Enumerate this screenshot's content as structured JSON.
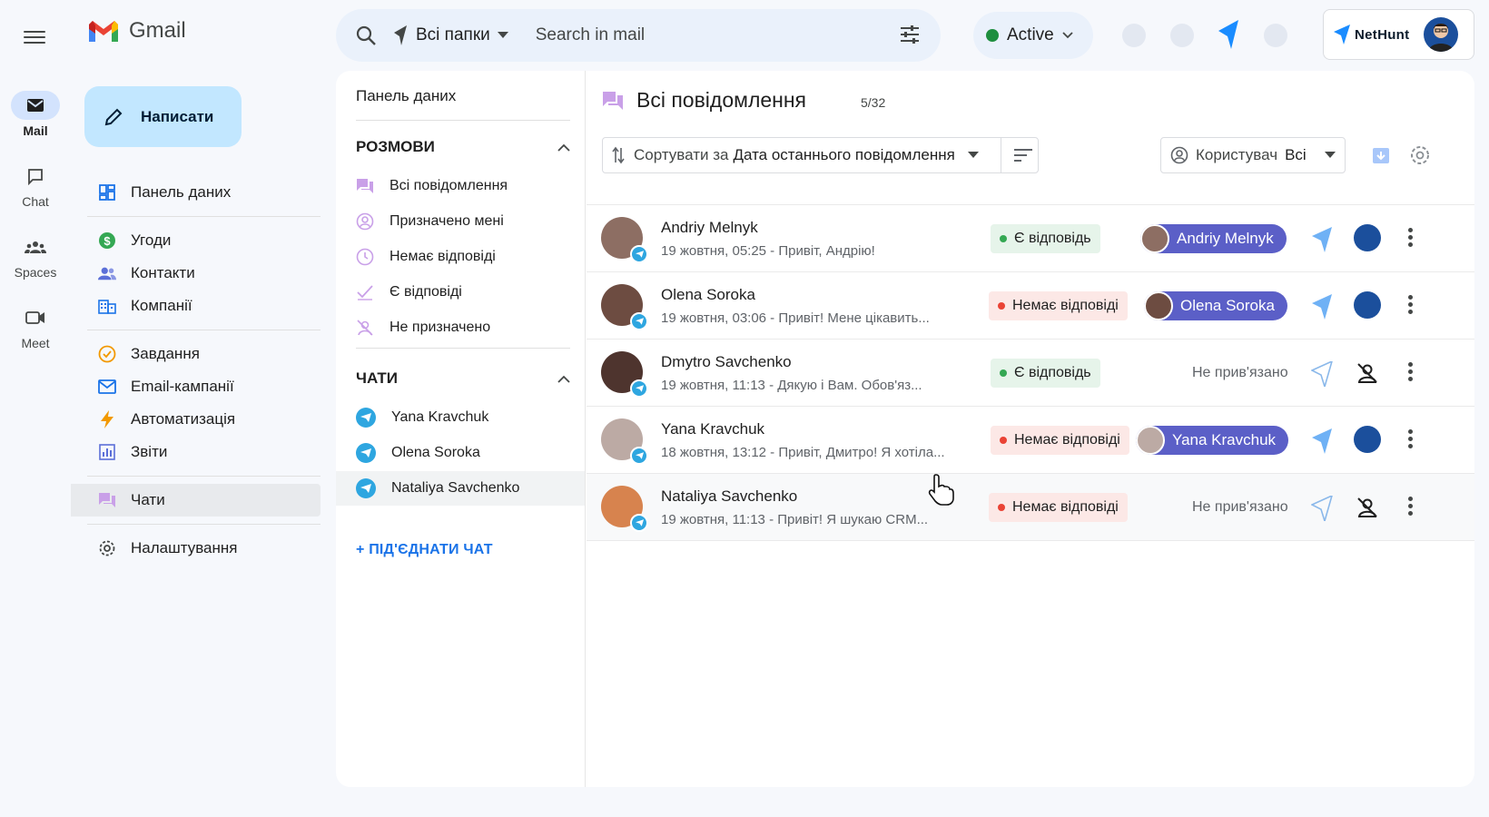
{
  "rail": {
    "items": [
      {
        "label": "Mail",
        "icon": "mail-icon"
      },
      {
        "label": "Chat",
        "icon": "chat-icon"
      },
      {
        "label": "Spaces",
        "icon": "spaces-icon"
      },
      {
        "label": "Meet",
        "icon": "meet-icon"
      }
    ]
  },
  "app": {
    "name": "Gmail"
  },
  "compose": {
    "label": "Написати"
  },
  "nav": {
    "items": [
      {
        "label": "Панель даних",
        "icon": "dashboard-icon"
      },
      {
        "label": "Угоди",
        "icon": "deals-icon"
      },
      {
        "label": "Контакти",
        "icon": "contacts-icon"
      },
      {
        "label": "Компанії",
        "icon": "companies-icon"
      },
      {
        "label": "Завдання",
        "icon": "tasks-icon"
      },
      {
        "label": "Email-кампанії",
        "icon": "email-campaigns-icon"
      },
      {
        "label": "Автоматизація",
        "icon": "automation-icon"
      },
      {
        "label": "Звіти",
        "icon": "reports-icon"
      },
      {
        "label": "Чати",
        "icon": "chats-icon"
      },
      {
        "label": "Налаштування",
        "icon": "settings-icon"
      }
    ]
  },
  "search": {
    "folder": "Всі папки",
    "placeholder": "Search in mail"
  },
  "status": {
    "label": "Active",
    "color": "#1e8e3e"
  },
  "brand": {
    "name": "NetHunt",
    "accent": "#1a73e8"
  },
  "leftPanel": {
    "title": "Панель даних",
    "conversations": {
      "heading": "РОЗМОВИ",
      "items": [
        {
          "label": "Всі повідомлення"
        },
        {
          "label": "Призначено мені"
        },
        {
          "label": "Немає відповіді"
        },
        {
          "label": "Є відповіді"
        },
        {
          "label": "Не призначено"
        }
      ]
    },
    "chats": {
      "heading": "ЧАТИ",
      "items": [
        {
          "label": "Yana Kravchuk"
        },
        {
          "label": "Olena Soroka"
        },
        {
          "label": "Nataliya Savchenko"
        }
      ]
    },
    "connect": "+ ПІД'ЄДНАТИ ЧАТ"
  },
  "main": {
    "title": "Всі повідомлення",
    "count": "5/32",
    "sort": {
      "prefix": "Сортувати за",
      "value": "Дата останнього повідомлення"
    },
    "userFilter": {
      "prefix": "Користувач",
      "value": "Всі"
    },
    "rows": [
      {
        "name": "Andriy Melnyk",
        "preview": "19 жовтня, 05:25 - Привіт, Андрію!",
        "status": "Є відповідь",
        "statusType": "yes",
        "linked": "Andriy Melnyk",
        "avatarColor": "#8d6e63"
      },
      {
        "name": "Olena Soroka",
        "preview": "19 жовтня, 03:06 - Привіт! Мене цікавить...",
        "status": "Немає відповіді",
        "statusType": "no",
        "linked": "Olena Soroka",
        "avatarColor": "#6d4c41"
      },
      {
        "name": "Dmytro Savchenko",
        "preview": "19 жовтня, 11:13 - Дякую і Вам. Обов'яз...",
        "status": "Є відповідь",
        "statusType": "yes",
        "linked": "",
        "unlinked": "Не прив'язано",
        "avatarColor": "#4e342e"
      },
      {
        "name": "Yana Kravchuk",
        "preview": "18 жовтня, 13:12 - Привіт, Дмитро! Я хотіла...",
        "status": "Немає відповіді",
        "statusType": "no",
        "linked": "Yana Kravchuk",
        "avatarColor": "#bcaaa4"
      },
      {
        "name": "Nataliya Savchenko",
        "preview": "19 жовтня, 11:13 - Привіт! Я шукаю CRM...",
        "status": "Немає відповіді",
        "statusType": "no",
        "linked": "",
        "unlinked": "Не прив'язано",
        "avatarColor": "#d7834e"
      }
    ]
  }
}
